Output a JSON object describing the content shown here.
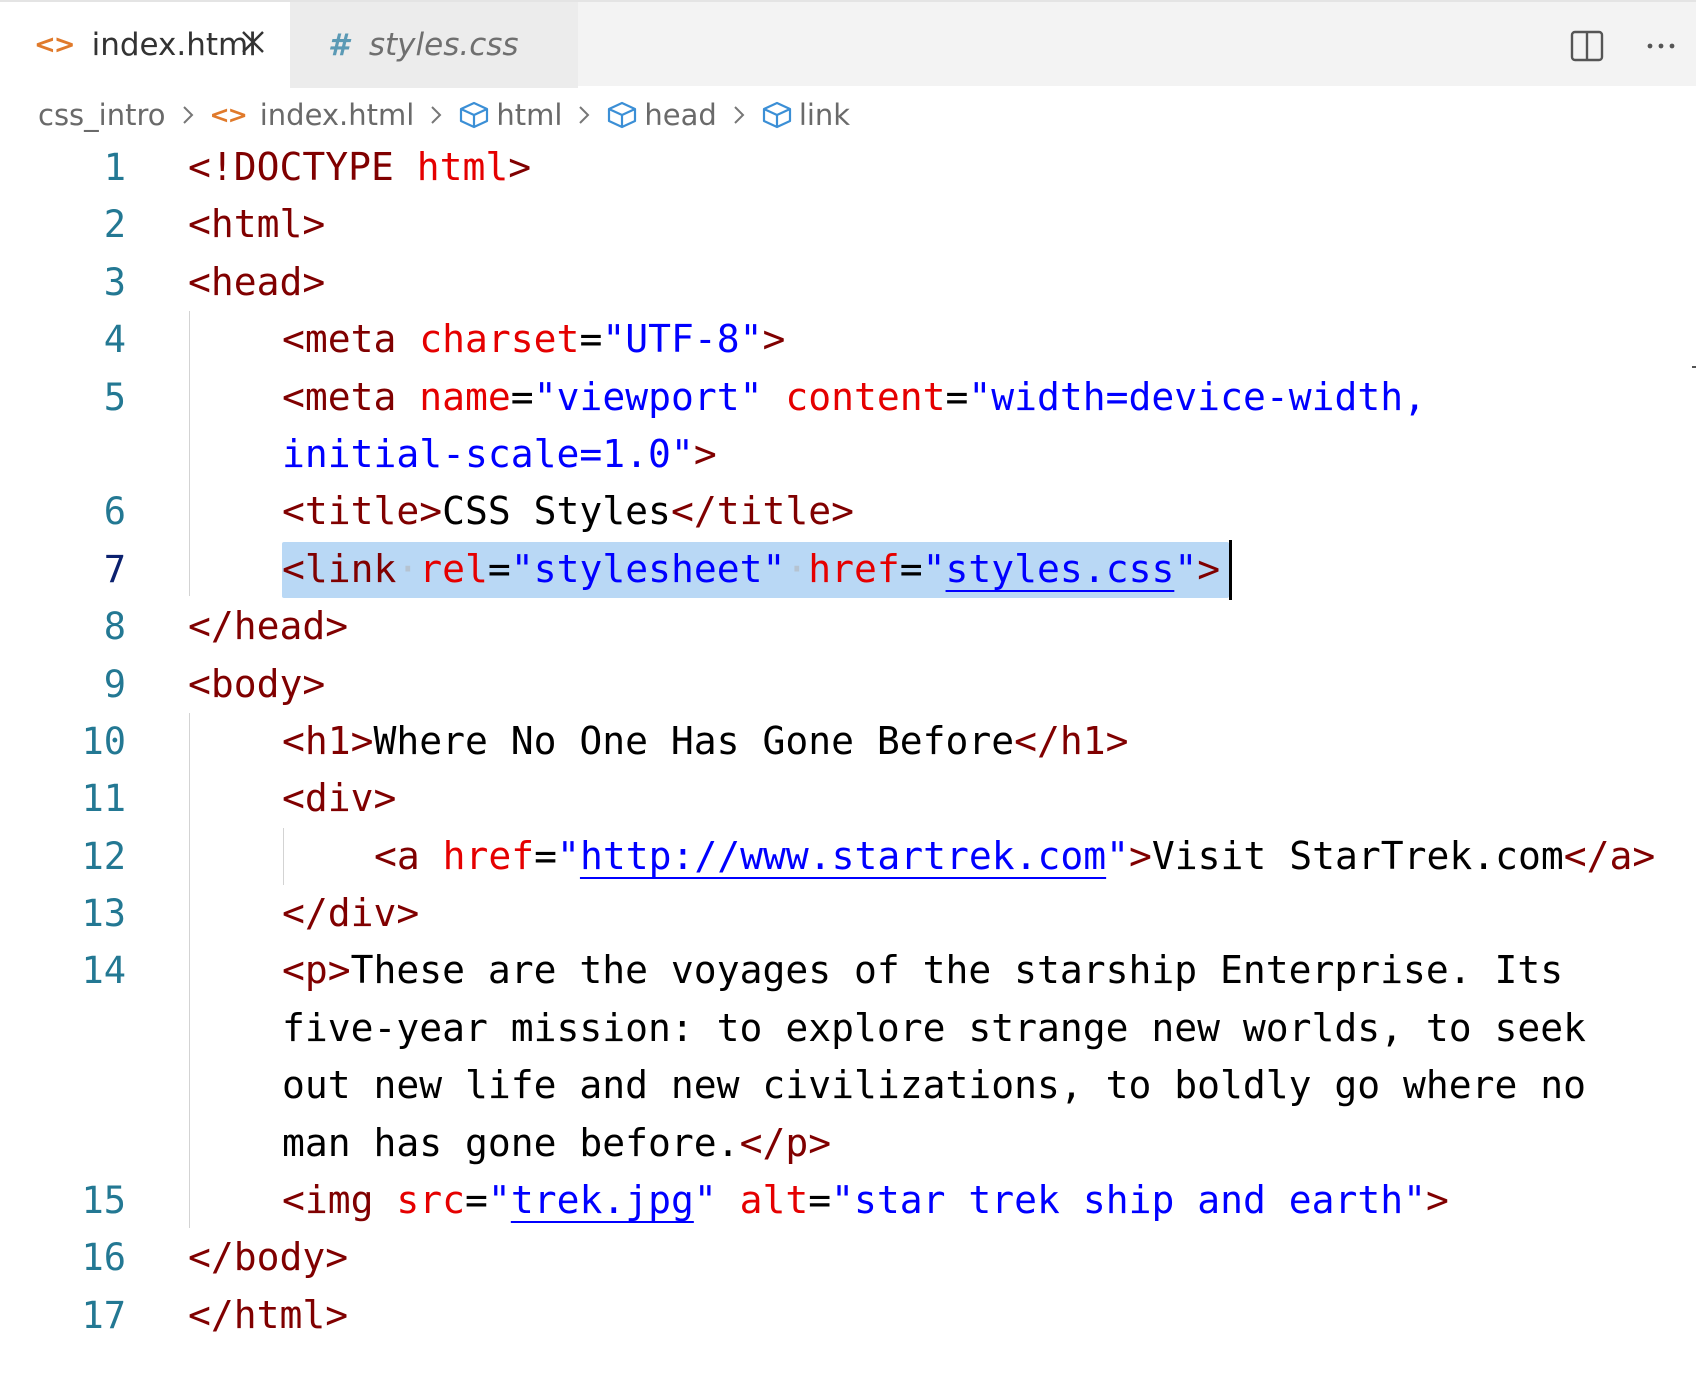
{
  "tabs": [
    {
      "label": "index.html",
      "icon": "html-file-icon",
      "active": true
    },
    {
      "label": "styles.css",
      "icon": "css-hash-icon",
      "active": false
    }
  ],
  "tab_icons": {
    "html": "<>",
    "css": "#"
  },
  "breadcrumb": [
    "css_intro",
    "index.html",
    "html",
    "head",
    "link"
  ],
  "editor": {
    "active_line": 7,
    "line_numbers": [
      "1",
      "2",
      "3",
      "4",
      "5",
      "",
      "6",
      "7",
      "8",
      "9",
      "10",
      "11",
      "12",
      "13",
      "14",
      "",
      "",
      "",
      "15",
      "16",
      "17"
    ]
  },
  "code": {
    "l1": {
      "a": "<!DOCTYPE ",
      "b": "html",
      "c": ">"
    },
    "l2": {
      "a": "<html>"
    },
    "l3": {
      "a": "<head>"
    },
    "l4": {
      "a": "<meta ",
      "b": "charset",
      "c": "=",
      "d": "\"UTF-8\"",
      "e": ">"
    },
    "l5": {
      "a": "<meta ",
      "b": "name",
      "c": "=",
      "d": "\"viewport\"",
      "e": " ",
      "f": "content",
      "g": "=",
      "h": "\"width=device-width,"
    },
    "l5b": {
      "a": "initial-scale=1.0\"",
      "b": ">"
    },
    "l6": {
      "a": "<title>",
      "b": "CSS Styles",
      "c": "</title>"
    },
    "l7": {
      "a": "<link",
      "ws1": "·",
      "b": "rel",
      "c": "=",
      "d": "\"stylesheet\"",
      "ws2": "·",
      "e": "href",
      "f": "=",
      "g": "\"",
      "h": "styles.css",
      "i": "\"",
      "j": ">"
    },
    "l8": {
      "a": "</head>"
    },
    "l9": {
      "a": "<body>"
    },
    "l10": {
      "a": "<h1>",
      "b": "Where No One Has Gone Before",
      "c": "</h1>"
    },
    "l11": {
      "a": "<div>"
    },
    "l12": {
      "a": "<a ",
      "b": "href",
      "c": "=",
      "d": "\"",
      "e": "http://www.startrek.com",
      "f": "\"",
      "g": ">",
      "h": "Visit StarTrek.com",
      "i": "</a>"
    },
    "l13": {
      "a": "</div>"
    },
    "l14": {
      "a": "<p>",
      "b": "These are the voyages of the starship Enterprise. Its"
    },
    "l14b": "five-year mission: to explore strange new worlds, to seek",
    "l14c": "out new life and new civilizations, to boldly go where no",
    "l14d": {
      "a": "man has gone before.",
      "b": "</p>"
    },
    "l15": {
      "a": "<img ",
      "b": "src",
      "c": "=",
      "d": "\"",
      "e": "trek.jpg",
      "f": "\"",
      "g": " ",
      "h": "alt",
      "i": "=",
      "j": "\"star trek ship and earth\"",
      "k": ">"
    },
    "l16": {
      "a": "</body>"
    },
    "l17": {
      "a": "</html>"
    }
  },
  "colors": {
    "tag": "#800000",
    "attribute": "#e50000",
    "string": "#0000ff",
    "text": "#000000",
    "line_number": "#237893",
    "selection": "#b9d8f5"
  }
}
